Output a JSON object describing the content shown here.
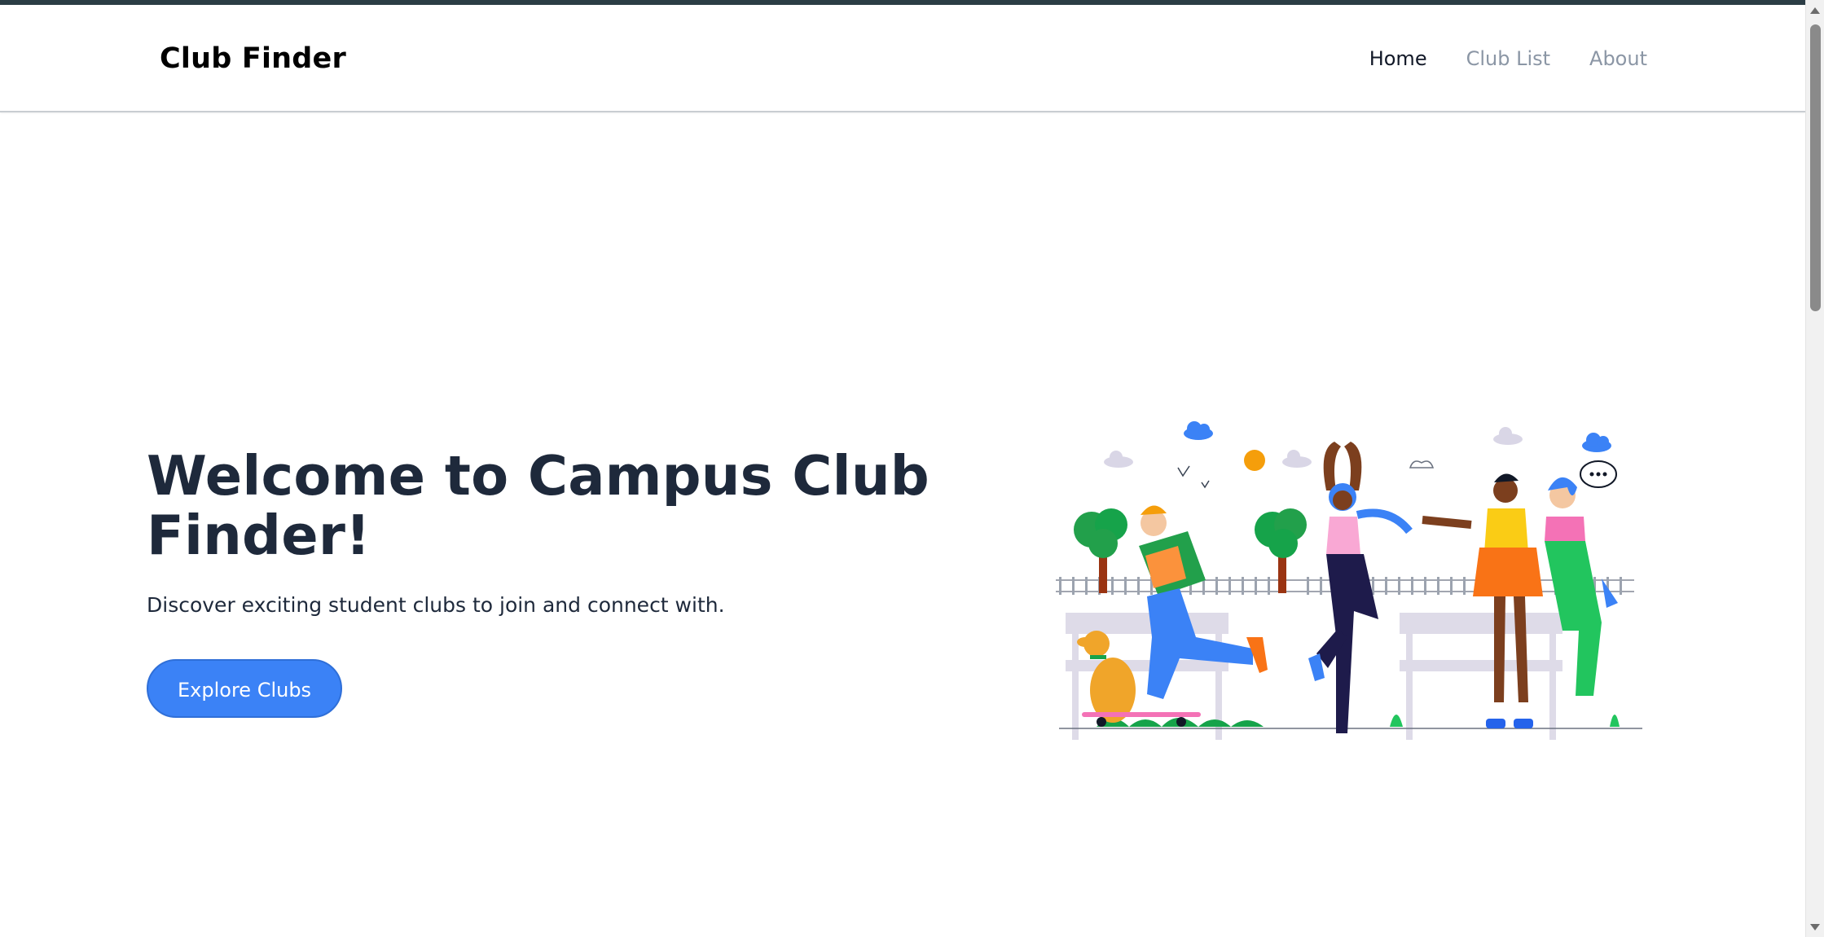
{
  "brand": "Club Finder",
  "nav": [
    {
      "label": "Home",
      "active": true
    },
    {
      "label": "Club List",
      "active": false
    },
    {
      "label": "About",
      "active": false
    }
  ],
  "hero": {
    "title": "Welcome to Campus Club Finder!",
    "subtitle": "Discover exciting student clubs to join and connect with.",
    "cta_label": "Explore Clubs"
  },
  "colors": {
    "accent": "#3b82f6",
    "heading": "#1e293b",
    "nav_inactive": "#8b96a5"
  },
  "illustration": "group of students outdoors in a park"
}
